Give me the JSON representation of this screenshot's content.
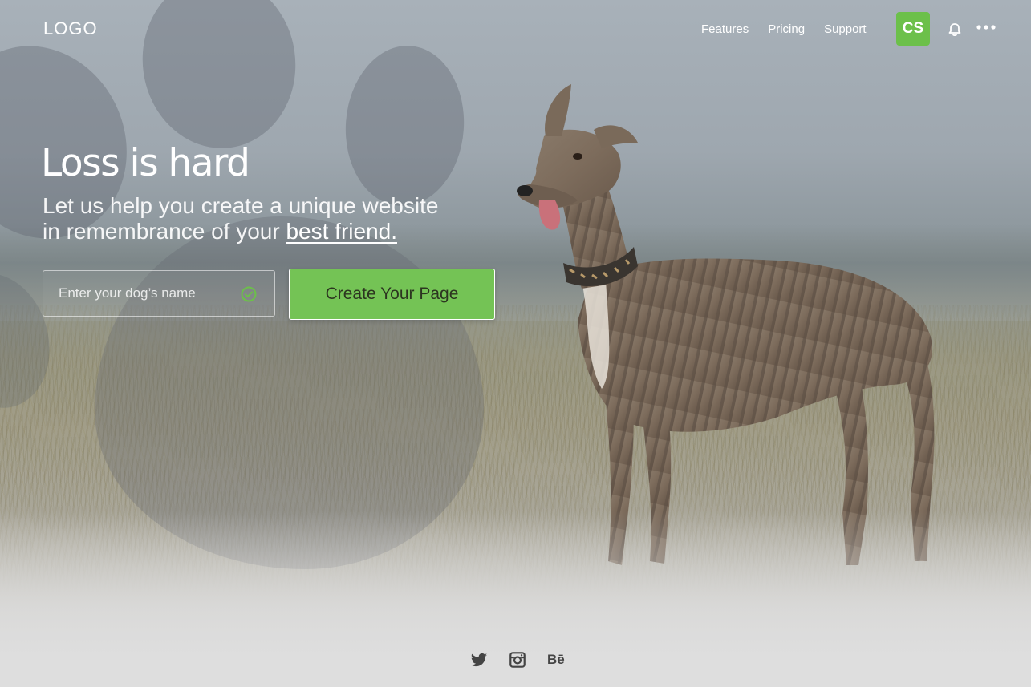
{
  "header": {
    "logo": "LOGO",
    "nav": [
      {
        "label": "Features"
      },
      {
        "label": "Pricing"
      },
      {
        "label": "Support"
      }
    ],
    "avatar_initials": "CS",
    "avatar_color": "#6cc04a",
    "icons": [
      "bell-icon",
      "more-icon"
    ]
  },
  "hero": {
    "title": "Loss is hard",
    "subtitle_line1": "Let us help you create a unique website",
    "subtitle_line2_prefix": "in remembrance of your ",
    "subtitle_link": "best friend."
  },
  "form": {
    "name_placeholder": "Enter your dog’s name",
    "name_value": "",
    "cta_label": "Create Your Page",
    "cta_color": "#74c355",
    "valid_indicator": "check-circle-icon"
  },
  "footer": {
    "social": [
      "twitter-icon",
      "instagram-icon",
      "behance-icon"
    ],
    "behance_text": "Bē"
  }
}
